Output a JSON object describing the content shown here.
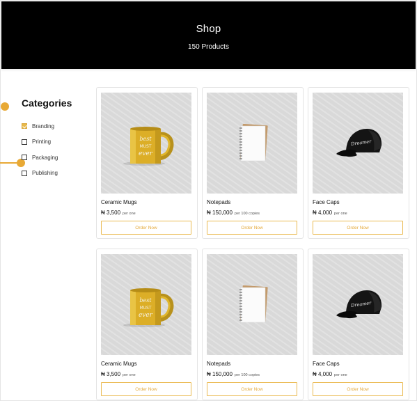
{
  "header": {
    "title": "Shop",
    "subtitle": "150 Products"
  },
  "sidebar": {
    "title": "Categories",
    "items": [
      {
        "label": "Branding",
        "checked": true
      },
      {
        "label": "Printing",
        "checked": false
      },
      {
        "label": "Packaging",
        "checked": false
      },
      {
        "label": "Publishing",
        "checked": false
      }
    ]
  },
  "products": [
    {
      "name": "Ceramic Mugs",
      "price": "₦ 3,500",
      "unit": "per one",
      "button": "Order Now",
      "image": "mug-image"
    },
    {
      "name": "Notepads",
      "price": "₦ 150,000",
      "unit": "per 100 copies",
      "button": "Order Now",
      "image": "notepad-image"
    },
    {
      "name": "Face Caps",
      "price": "₦ 4,000",
      "unit": "per one",
      "button": "Order Now",
      "image": "cap-image"
    },
    {
      "name": "Ceramic Mugs",
      "price": "₦ 3,500",
      "unit": "per one",
      "button": "Order Now",
      "image": "mug-image"
    },
    {
      "name": "Notepads",
      "price": "₦ 150,000",
      "unit": "per 100 copies",
      "button": "Order Now",
      "image": "notepad-image"
    },
    {
      "name": "Face Caps",
      "price": "₦ 4,000",
      "unit": "per one",
      "button": "Order Now",
      "image": "cap-image"
    }
  ],
  "colors": {
    "accent": "#e8a935",
    "header_bg": "#000000",
    "image_bg": "#dedede"
  }
}
